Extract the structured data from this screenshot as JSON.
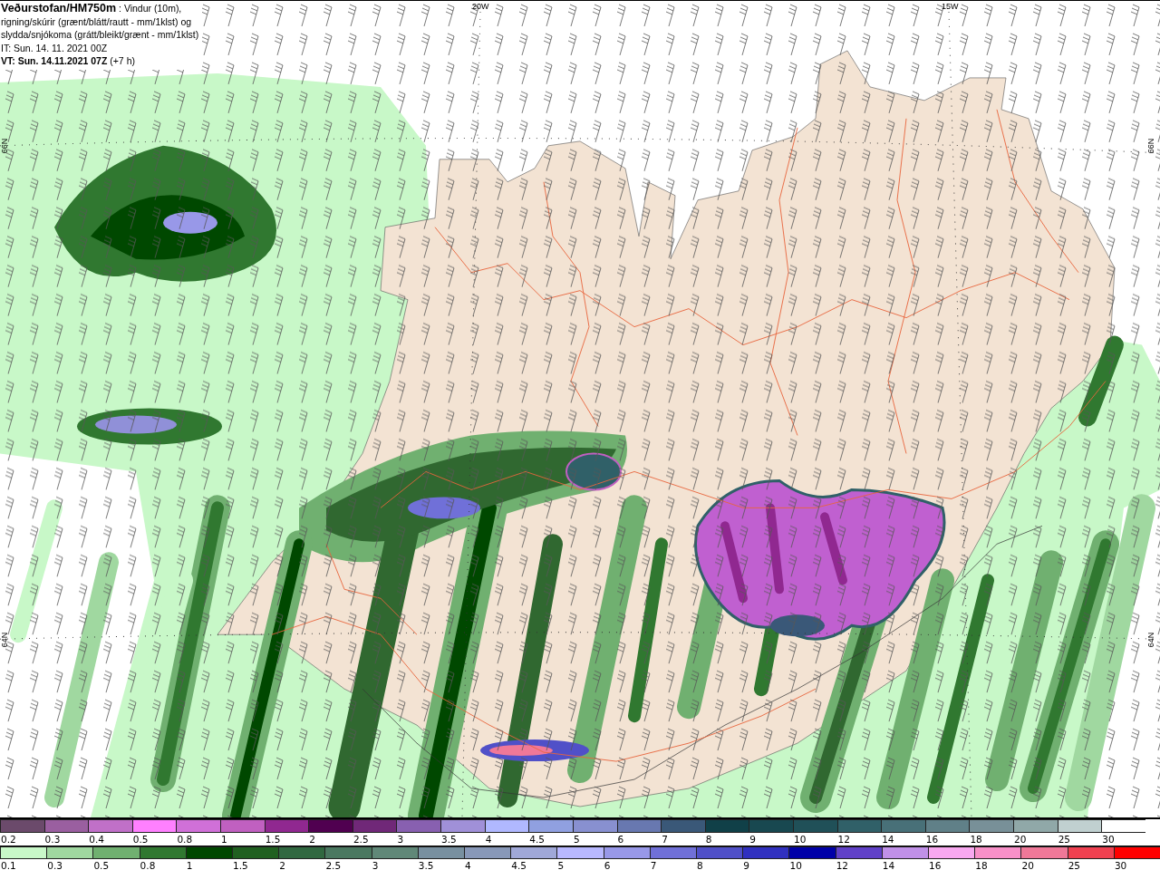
{
  "header": {
    "title": "**Veðurstofan/HM750m** : Vindur (10m),",
    "description": [
      "rigning/skúrir (grænt/blátt/rautt - mm/1klst) og",
      "slydda/snjókoma (grátt/bleikt/grænt - mm/1klst)"
    ],
    "initial_time": "IT: Sun. 14. 11. 2021 00Z",
    "valid_time": "**VT: Sun. 14.11.2021 07Z** (+7 h)"
  },
  "map": {
    "longitude_labels": [
      "20W",
      "15W"
    ],
    "latitude_labels_left": [
      "66N",
      "64N"
    ],
    "latitude_labels_right": [
      "66N",
      "64N"
    ]
  },
  "legend": {
    "scales": [
      [
        {
          "label": "0.2",
          "color": "#6b4a6b"
        },
        {
          "label": "0.3",
          "color": "#9a5fa0"
        },
        {
          "label": "0.4",
          "color": "#c070c8"
        },
        {
          "label": "0.5",
          "color": "#ff80ff"
        },
        {
          "label": "0.8",
          "color": "#d070d8"
        },
        {
          "label": "1",
          "color": "#c060c0"
        },
        {
          "label": "1.5",
          "color": "#902890"
        },
        {
          "label": "2",
          "color": "#500050"
        },
        {
          "label": "2.5",
          "color": "#702878"
        },
        {
          "label": "3",
          "color": "#8860b0"
        },
        {
          "label": "3.5",
          "color": "#a090d8"
        },
        {
          "label": "4",
          "color": "#b0b8ff"
        },
        {
          "label": "4.5",
          "color": "#90a0e0"
        },
        {
          "label": "5",
          "color": "#8890d0"
        },
        {
          "label": "6",
          "color": "#6878b0"
        },
        {
          "label": "7",
          "color": "#3a5878"
        },
        {
          "label": "8",
          "color": "#104048"
        },
        {
          "label": "9",
          "color": "#184850"
        },
        {
          "label": "10",
          "color": "#205058"
        },
        {
          "label": "12",
          "color": "#306068"
        },
        {
          "label": "14",
          "color": "#487078"
        },
        {
          "label": "16",
          "color": "#608088"
        },
        {
          "label": "18",
          "color": "#789098"
        },
        {
          "label": "20",
          "color": "#90a8a8"
        },
        {
          "label": "25",
          "color": "#c0d0d0"
        },
        {
          "label": "30",
          "color": "#ffffff"
        }
      ],
      [
        {
          "label": "0.1",
          "color": "#c8f8c8"
        },
        {
          "label": "0.3",
          "color": "#a0d8a0"
        },
        {
          "label": "0.5",
          "color": "#70b070"
        },
        {
          "label": "0.8",
          "color": "#307830"
        },
        {
          "label": "1",
          "color": "#004800"
        },
        {
          "label": "1.5",
          "color": "#206020"
        },
        {
          "label": "2",
          "color": "#306840"
        },
        {
          "label": "2.5",
          "color": "#4a7860"
        },
        {
          "label": "3",
          "color": "#608878"
        },
        {
          "label": "3.5",
          "color": "#7890a0"
        },
        {
          "label": "4",
          "color": "#8898b8"
        },
        {
          "label": "4.5",
          "color": "#a0a8d8"
        },
        {
          "label": "5",
          "color": "#b8b8ff"
        },
        {
          "label": "6",
          "color": "#9898e8"
        },
        {
          "label": "7",
          "color": "#7070d8"
        },
        {
          "label": "8",
          "color": "#5050c8"
        },
        {
          "label": "9",
          "color": "#3030c0"
        },
        {
          "label": "10",
          "color": "#0000a8"
        },
        {
          "label": "12",
          "color": "#6040c8"
        },
        {
          "label": "14",
          "color": "#c090e8"
        },
        {
          "label": "16",
          "color": "#f8a8f0"
        },
        {
          "label": "18",
          "color": "#f890c8"
        },
        {
          "label": "20",
          "color": "#f07898"
        },
        {
          "label": "25",
          "color": "#f04050"
        },
        {
          "label": "30",
          "color": "#ff0000"
        }
      ]
    ]
  }
}
